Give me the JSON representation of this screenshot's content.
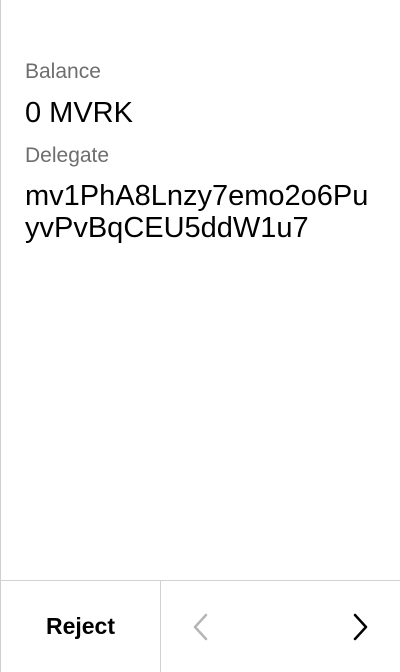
{
  "fields": {
    "balance_label": "Balance",
    "balance_value": "0 MVRK",
    "delegate_label": "Delegate",
    "delegate_value": "mv1PhA8Lnzy7emo2o6PuyvPvBqCEU5ddW1u7"
  },
  "footer": {
    "reject_label": "Reject",
    "prev_icon": "chevron-left-icon",
    "next_icon": "chevron-right-icon"
  },
  "colors": {
    "label": "#6e6e6e",
    "value": "#000000",
    "divider": "#d2d2d2",
    "disabled_icon": "#b5b5b5",
    "active_icon": "#000000"
  }
}
